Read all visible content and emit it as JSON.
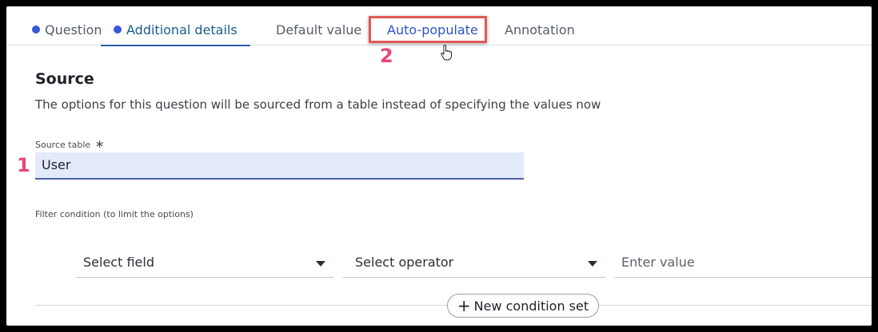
{
  "tabs": {
    "question": "Question",
    "additional_details": "Additional details",
    "default_value": "Default value",
    "auto_populate": "Auto-populate",
    "annotation": "Annotation"
  },
  "annotations": {
    "step1": "1",
    "step2": "2"
  },
  "section": {
    "title": "Source",
    "description": "The options for this question will be sourced from a table instead of specifying the values now"
  },
  "source_table": {
    "label": "Source table",
    "required_mark": "∗",
    "value": "User"
  },
  "filter": {
    "label": "Filter condition (to limit the options)",
    "field_placeholder": "Select field",
    "operator_placeholder": "Select operator",
    "value_placeholder": "Enter value"
  },
  "new_condition_set": {
    "label": "New condition set",
    "icon": "plus-icon"
  },
  "colors": {
    "accent": "#2a5ca8",
    "highlight_box": "#e05a57",
    "annotation": "#e8457b",
    "dot": "#3c55d6"
  }
}
